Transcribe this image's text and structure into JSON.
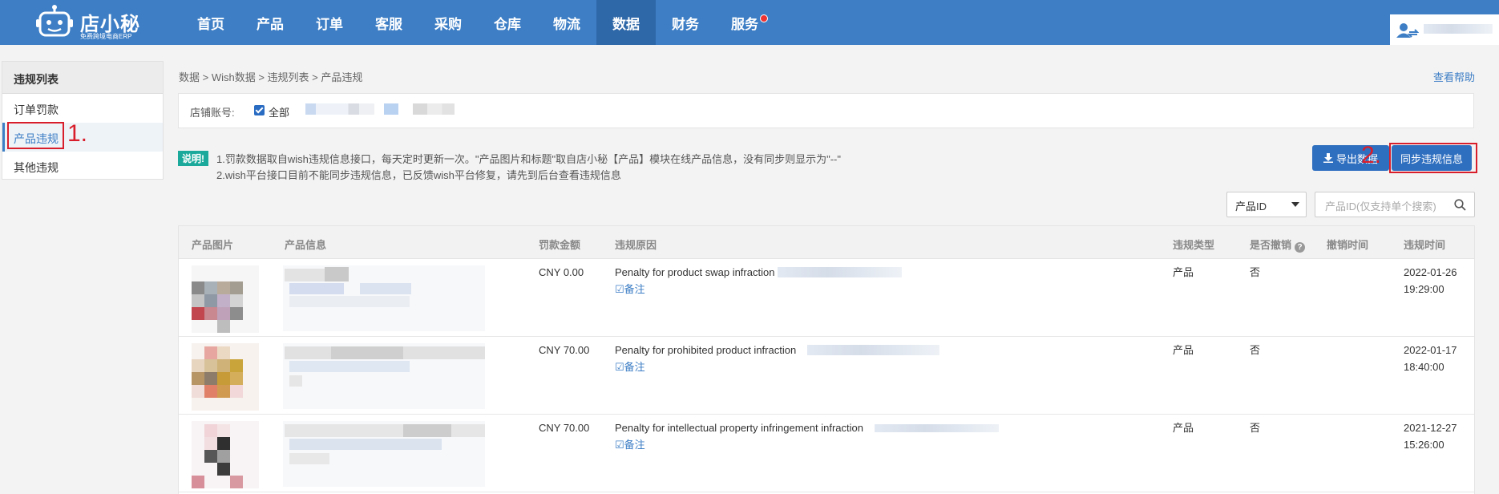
{
  "brand": {
    "name": "店小秘",
    "subtitle": "免费跨境电商ERP"
  },
  "nav": [
    {
      "label": "首页",
      "active": false
    },
    {
      "label": "产品",
      "active": false
    },
    {
      "label": "订单",
      "active": false
    },
    {
      "label": "客服",
      "active": false
    },
    {
      "label": "采购",
      "active": false
    },
    {
      "label": "仓库",
      "active": false
    },
    {
      "label": "物流",
      "active": false
    },
    {
      "label": "数据",
      "active": true
    },
    {
      "label": "财务",
      "active": false
    },
    {
      "label": "服务",
      "active": false,
      "has_dot": true
    }
  ],
  "sidebar": {
    "title": "违规列表",
    "items": [
      {
        "label": "订单罚款",
        "active": false
      },
      {
        "label": "产品违规",
        "active": true
      },
      {
        "label": "其他违规",
        "active": false
      }
    ]
  },
  "annotations": {
    "step1": "1.",
    "step2": "2."
  },
  "breadcrumb": "数据 > Wish数据 > 违规列表 > 产品违规",
  "help_link": "查看帮助",
  "filter": {
    "label": "店铺账号:",
    "all_label": "全部",
    "all_checked": true
  },
  "notice": {
    "badge": "说明!",
    "line1": "1.罚款数据取自wish违规信息接口，每天定时更新一次。\"产品图片和标题\"取自店小秘【产品】模块在线产品信息，没有同步则显示为\"--\"",
    "line2": "2.wish平台接口目前不能同步违规信息，已反馈wish平台修复，请先到后台查看违规信息"
  },
  "buttons": {
    "export": "导出数据",
    "sync": "同步违规信息"
  },
  "search": {
    "field_select": "产品ID",
    "placeholder": "产品ID(仅支持单个搜索)"
  },
  "table": {
    "headers": {
      "image": "产品图片",
      "info": "产品信息",
      "amount": "罚款金额",
      "reason": "违规原因",
      "type": "违规类型",
      "revoked": "是否撤销",
      "revoke_time": "撤销时间",
      "time": "违规时间"
    },
    "remark_label": "备注",
    "rows": [
      {
        "amount": "CNY 0.00",
        "reason": "Penalty for product swap infraction",
        "type": "产品",
        "revoked": "否",
        "date": "2022-01-26",
        "time": "19:29:00"
      },
      {
        "amount": "CNY 70.00",
        "reason": "Penalty for prohibited product infraction",
        "type": "产品",
        "revoked": "否",
        "date": "2022-01-17",
        "time": "18:40:00"
      },
      {
        "amount": "CNY 70.00",
        "reason": "Penalty for intellectual property infringement infraction",
        "type": "产品",
        "revoked": "否",
        "date": "2021-12-27",
        "time": "15:26:00"
      }
    ]
  },
  "colors": {
    "nav_bg": "#3d7ec5",
    "nav_active": "#2f68a8",
    "annotation_red": "#d91e2b",
    "button_blue": "#2f6fbf"
  }
}
